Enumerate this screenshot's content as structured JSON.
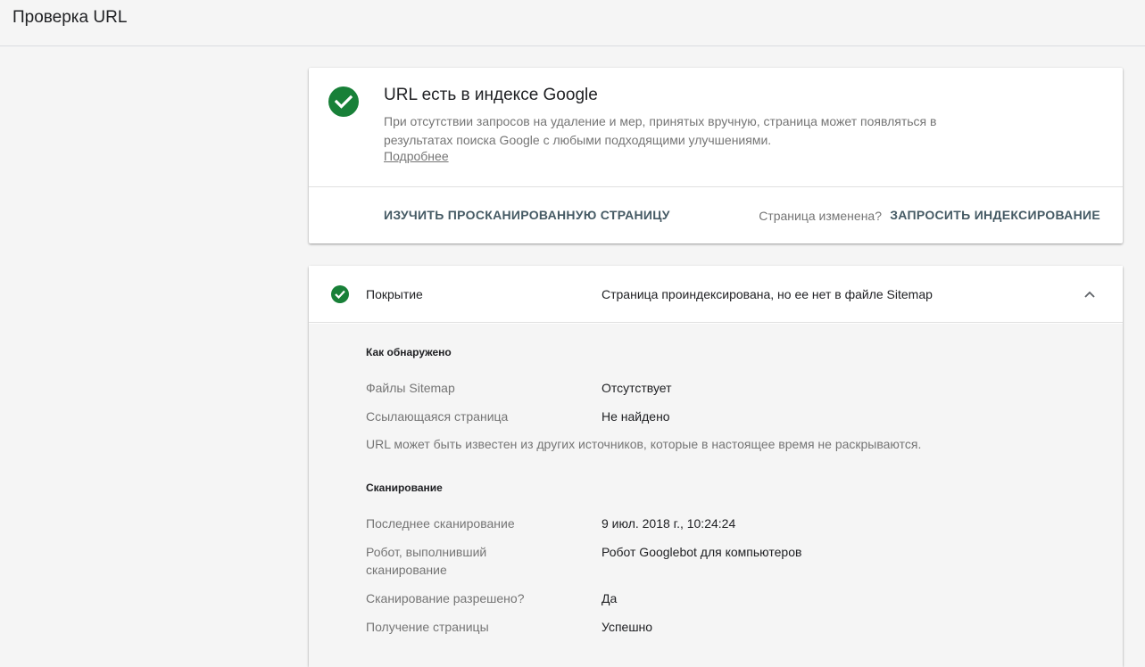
{
  "header": {
    "title": "Проверка URL"
  },
  "status": {
    "title": "URL есть в индексе Google",
    "description": "При отсутствии запросов на удаление и мер, принятых вручную, страница может появляться в результатах поиска Google с любыми подходящими улучшениями.",
    "learn_more": "Подробнее",
    "inspect_button": "ИЗУЧИТЬ ПРОСКАНИРОВАННУЮ СТРАНИЦУ",
    "changed_question": "Страница изменена?",
    "request_button": "ЗАПРОСИТЬ ИНДЕКСИРОВАНИЕ",
    "accent_color": "#188038"
  },
  "coverage": {
    "label": "Покрытие",
    "value": "Страница проиндексирована, но ее нет в файле Sitemap",
    "expanded": true,
    "discovery": {
      "heading": "Как обнаружено",
      "rows": [
        {
          "label": "Файлы Sitemap",
          "value": "Отсутствует"
        },
        {
          "label": "Ссылающаяся страница",
          "value": "Не найдено"
        }
      ],
      "note": "URL может быть известен из других источников, которые в настоящее время не раскрываются."
    },
    "crawl": {
      "heading": "Сканирование",
      "rows": [
        {
          "label": "Последнее сканирование",
          "value": "9 июл. 2018 г., 10:24:24"
        },
        {
          "label": "Робот, выполнивший сканирование",
          "value": "Робот Googlebot для компьютеров"
        },
        {
          "label": "Сканирование разрешено?",
          "value": "Да"
        },
        {
          "label": "Получение страницы",
          "value": "Успешно"
        }
      ]
    }
  }
}
